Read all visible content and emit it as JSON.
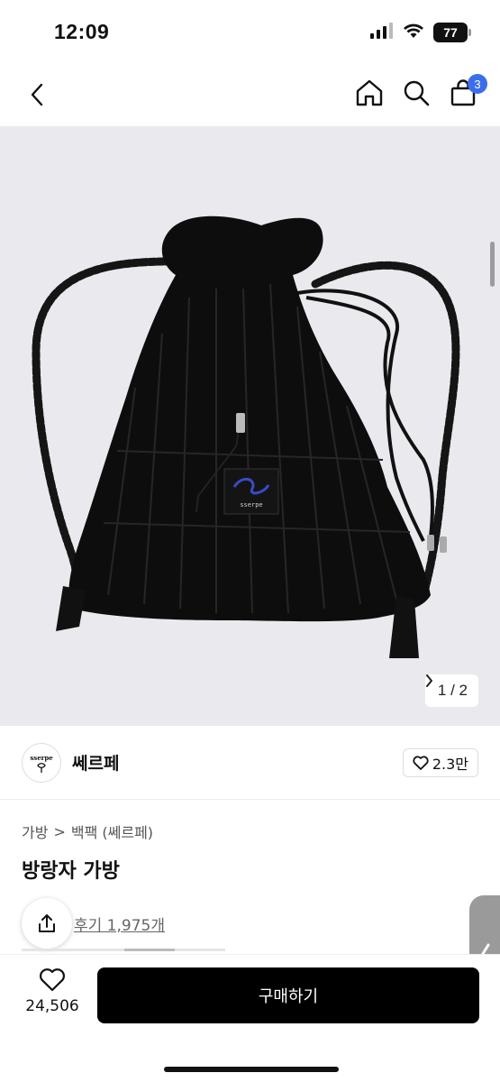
{
  "status_bar": {
    "time": "12:09",
    "battery": "77"
  },
  "nav": {
    "cart_count": "3"
  },
  "gallery": {
    "page_indicator": "1 / 2",
    "product_label_text": "sserpe"
  },
  "shop": {
    "name": "쎄르페",
    "likes": "2.3만",
    "logo_text": "sserpe"
  },
  "breadcrumb": {
    "category": "가방",
    "separator": ">",
    "subcategory": "백팩 (쎄르페)"
  },
  "product": {
    "title": "방랑자 가방",
    "reviews": "후기 1,975개"
  },
  "bottom_bar": {
    "wish_count": "24,506",
    "buy_label": "구매하기"
  },
  "colors": {
    "accent": "#3b6ee8",
    "buy_button": "#000000",
    "gallery_bg": "#eaeaee"
  },
  "icons": [
    "back-icon",
    "home-icon",
    "search-icon",
    "cart-icon",
    "heart-icon",
    "share-icon",
    "chevron-right-icon",
    "chevron-left-icon"
  ]
}
